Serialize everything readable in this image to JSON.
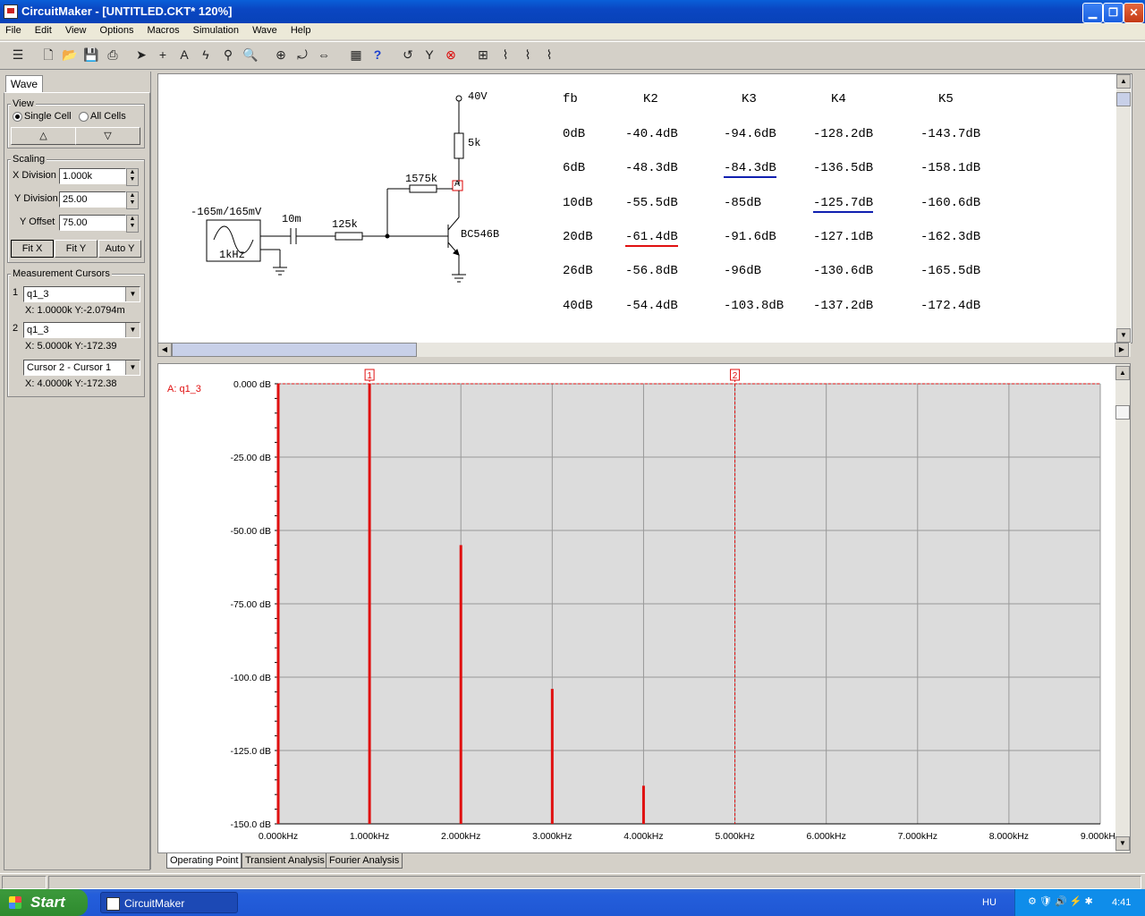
{
  "window": {
    "title": "CircuitMaker - [UNTITLED.CKT* 120%]"
  },
  "menu": [
    "File",
    "Edit",
    "View",
    "Options",
    "Macros",
    "Simulation",
    "Wave",
    "Help"
  ],
  "left_panel": {
    "tab": "Wave",
    "view": {
      "label": "View",
      "single": "Single Cell",
      "all": "All Cells",
      "up": "△",
      "down": "▽"
    },
    "scaling": {
      "label": "Scaling",
      "x_label": "X Division",
      "x_value": "1.000k",
      "y_label": "Y Division",
      "y_value": "25.00",
      "off_label": "Y Offset",
      "off_value": "75.00",
      "fitx": "Fit X",
      "fity": "Fit Y",
      "autoy": "Auto Y"
    },
    "cursors": {
      "label": "Measurement Cursors",
      "c1_num": "1",
      "c1_sel": "q1_3",
      "c1_read": "X: 1.0000k  Y:-2.0794m",
      "c2_num": "2",
      "c2_sel": "q1_3",
      "c2_read": "X: 5.0000k  Y:-172.39",
      "diff_sel": "Cursor 2 - Cursor 1",
      "diff_read": "X: 4.0000k  Y:-172.38"
    }
  },
  "schematic": {
    "vcc": "40V",
    "r_load": "5k",
    "r_fb": "1575k",
    "probe": "A",
    "transistor": "BC546B",
    "cap": "10m",
    "r_in": "125k",
    "src_amp": "-165m/165mV",
    "src_freq": "1kHz",
    "table": {
      "headers": [
        "fb",
        "K2",
        "K3",
        "K4",
        "K5"
      ],
      "rows": [
        [
          "0dB",
          "-40.4dB",
          "-94.6dB",
          "-128.2dB",
          "-143.7dB"
        ],
        [
          "6dB",
          "-48.3dB",
          "-84.3dB",
          "-136.5dB",
          "-158.1dB"
        ],
        [
          "10dB",
          "-55.5dB",
          "-85dB",
          "-125.7dB",
          "-160.6dB"
        ],
        [
          "20dB",
          "-61.4dB",
          "-91.6dB",
          "-127.1dB",
          "-162.3dB"
        ],
        [
          "26dB",
          "-56.8dB",
          "-96dB",
          "-130.6dB",
          "-165.5dB"
        ],
        [
          "40dB",
          "-54.4dB",
          "-103.8dB",
          "-137.2dB",
          "-172.4dB"
        ]
      ],
      "underline_blue": [
        "6dB:K3",
        "10dB:K4"
      ],
      "underline_red": [
        "20dB:K2"
      ]
    }
  },
  "chart_data": {
    "type": "bar",
    "trace_label": "A: q1_3",
    "x_unit": "kHz",
    "x_ticks": [
      "0.000kHz",
      "1.000kHz",
      "2.000kHz",
      "3.000kHz",
      "4.000kHz",
      "5.000kHz",
      "6.000kHz",
      "7.000kHz",
      "8.000kHz",
      "9.000kHz"
    ],
    "y_ticks": [
      "0.000 dB",
      "-25.00 dB",
      "-50.00 dB",
      "-75.00 dB",
      "-100.0 dB",
      "-125.0 dB",
      "-150.0 dB"
    ],
    "xlim": [
      0,
      9
    ],
    "ylim": [
      -150,
      0
    ],
    "x": [
      0,
      1,
      2,
      3,
      4
    ],
    "values": [
      0,
      0,
      -55,
      -104,
      -137
    ],
    "cursors": [
      {
        "label": "1",
        "x": 1
      },
      {
        "label": "2",
        "x": 5
      }
    ],
    "color": "#e01010"
  },
  "tabs": [
    "Operating Point",
    "Transient Analysis",
    "Fourier Analysis"
  ],
  "taskbar": {
    "start": "Start",
    "task": "CircuitMaker",
    "lang": "HU",
    "clock": "4:41"
  }
}
